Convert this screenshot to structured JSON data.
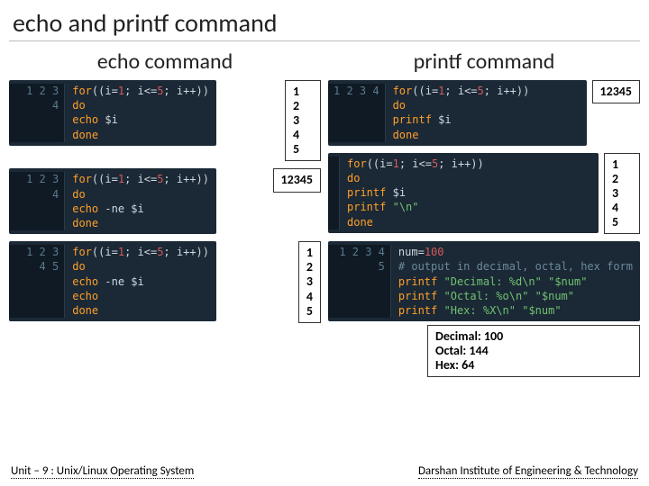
{
  "title": "echo and printf command",
  "left_heading": "echo command",
  "right_heading": "printf command",
  "echo": {
    "block1_gutter": "1\n2\n3\n4",
    "block1_code": [
      {
        "t": "for",
        "c": "kw"
      },
      {
        "t": "((i="
      },
      {
        "t": "1",
        "c": "num"
      },
      {
        "t": "; i<="
      },
      {
        "t": "5",
        "c": "num"
      },
      {
        "t": "; i++))"
      },
      {
        "nl": true
      },
      {
        "t": "do",
        "c": "kw"
      },
      {
        "nl": true
      },
      {
        "t": "echo",
        "c": "kw"
      },
      {
        "t": " "
      },
      {
        "t": "$i",
        "c": "var"
      },
      {
        "nl": true
      },
      {
        "t": "done",
        "c": "kw"
      }
    ],
    "out1": "1\n2\n3\n4\n5",
    "block2_gutter": "1\n2\n3\n4",
    "block2_code": [
      {
        "t": "for",
        "c": "kw"
      },
      {
        "t": "((i="
      },
      {
        "t": "1",
        "c": "num"
      },
      {
        "t": "; i<="
      },
      {
        "t": "5",
        "c": "num"
      },
      {
        "t": "; i++))"
      },
      {
        "nl": true
      },
      {
        "t": "do",
        "c": "kw"
      },
      {
        "nl": true
      },
      {
        "t": "echo",
        "c": "kw"
      },
      {
        "t": " -ne "
      },
      {
        "t": "$i",
        "c": "var"
      },
      {
        "nl": true
      },
      {
        "t": "done",
        "c": "kw"
      }
    ],
    "out2": "12345",
    "block3_gutter": "1\n2\n3\n4\n5",
    "block3_code": [
      {
        "t": "for",
        "c": "kw"
      },
      {
        "t": "((i="
      },
      {
        "t": "1",
        "c": "num"
      },
      {
        "t": "; i<="
      },
      {
        "t": "5",
        "c": "num"
      },
      {
        "t": "; i++))"
      },
      {
        "nl": true
      },
      {
        "t": "do",
        "c": "kw"
      },
      {
        "nl": true
      },
      {
        "t": "echo",
        "c": "kw"
      },
      {
        "t": " -ne "
      },
      {
        "t": "$i",
        "c": "var"
      },
      {
        "nl": true
      },
      {
        "t": "echo",
        "c": "kw"
      },
      {
        "nl": true
      },
      {
        "t": "done",
        "c": "kw"
      }
    ],
    "out3": "1\n2\n3\n4\n5"
  },
  "printf": {
    "block1_gutter": "1\n2\n3\n4",
    "block1_code": [
      {
        "t": "for",
        "c": "kw"
      },
      {
        "t": "((i="
      },
      {
        "t": "1",
        "c": "num"
      },
      {
        "t": "; i<="
      },
      {
        "t": "5",
        "c": "num"
      },
      {
        "t": "; i++))"
      },
      {
        "nl": true
      },
      {
        "t": "do",
        "c": "kw"
      },
      {
        "nl": true
      },
      {
        "t": "printf",
        "c": "kw"
      },
      {
        "t": " "
      },
      {
        "t": "$i",
        "c": "var"
      },
      {
        "nl": true
      },
      {
        "t": "done",
        "c": "kw"
      }
    ],
    "out1": "12345",
    "block2_gutter": " \n \n \n \n ",
    "block2_code": [
      {
        "t": "for",
        "c": "kw"
      },
      {
        "t": "((i="
      },
      {
        "t": "1",
        "c": "num"
      },
      {
        "t": "; i<="
      },
      {
        "t": "5",
        "c": "num"
      },
      {
        "t": "; i++))"
      },
      {
        "nl": true
      },
      {
        "t": "do",
        "c": "kw"
      },
      {
        "nl": true
      },
      {
        "t": "printf",
        "c": "kw"
      },
      {
        "t": " "
      },
      {
        "t": "$i",
        "c": "var"
      },
      {
        "nl": true
      },
      {
        "t": "printf",
        "c": "kw"
      },
      {
        "t": " "
      },
      {
        "t": "\"\\n\"",
        "c": "str"
      },
      {
        "nl": true
      },
      {
        "t": "done",
        "c": "kw"
      }
    ],
    "out2": "1\n2\n3\n4\n5",
    "block3_gutter": "1\n2\n3\n4\n5",
    "block3_code": [
      {
        "t": "num",
        "c": "var"
      },
      {
        "t": "="
      },
      {
        "t": "100",
        "c": "num"
      },
      {
        "nl": true
      },
      {
        "t": "# output in decimal, octal, hex form",
        "c": "cmt"
      },
      {
        "nl": true
      },
      {
        "t": "printf",
        "c": "kw"
      },
      {
        "t": " "
      },
      {
        "t": "\"Decimal: %d\\n\"",
        "c": "str"
      },
      {
        "t": " "
      },
      {
        "t": "\"$num\"",
        "c": "str"
      },
      {
        "nl": true
      },
      {
        "t": "printf",
        "c": "kw"
      },
      {
        "t": " "
      },
      {
        "t": "\"Octal: %o\\n\"",
        "c": "str"
      },
      {
        "t": " "
      },
      {
        "t": "\"$num\"",
        "c": "str"
      },
      {
        "nl": true
      },
      {
        "t": "printf",
        "c": "kw"
      },
      {
        "t": " "
      },
      {
        "t": "\"Hex: %X\\n\"",
        "c": "str"
      },
      {
        "t": " "
      },
      {
        "t": "\"$num\"",
        "c": "str"
      }
    ],
    "out3": "Decimal: 100\nOctal: 144\nHex: 64"
  },
  "footer_left": "Unit – 9 : Unix/Linux Operating System",
  "footer_right": "Darshan Institute of Engineering & Technology"
}
